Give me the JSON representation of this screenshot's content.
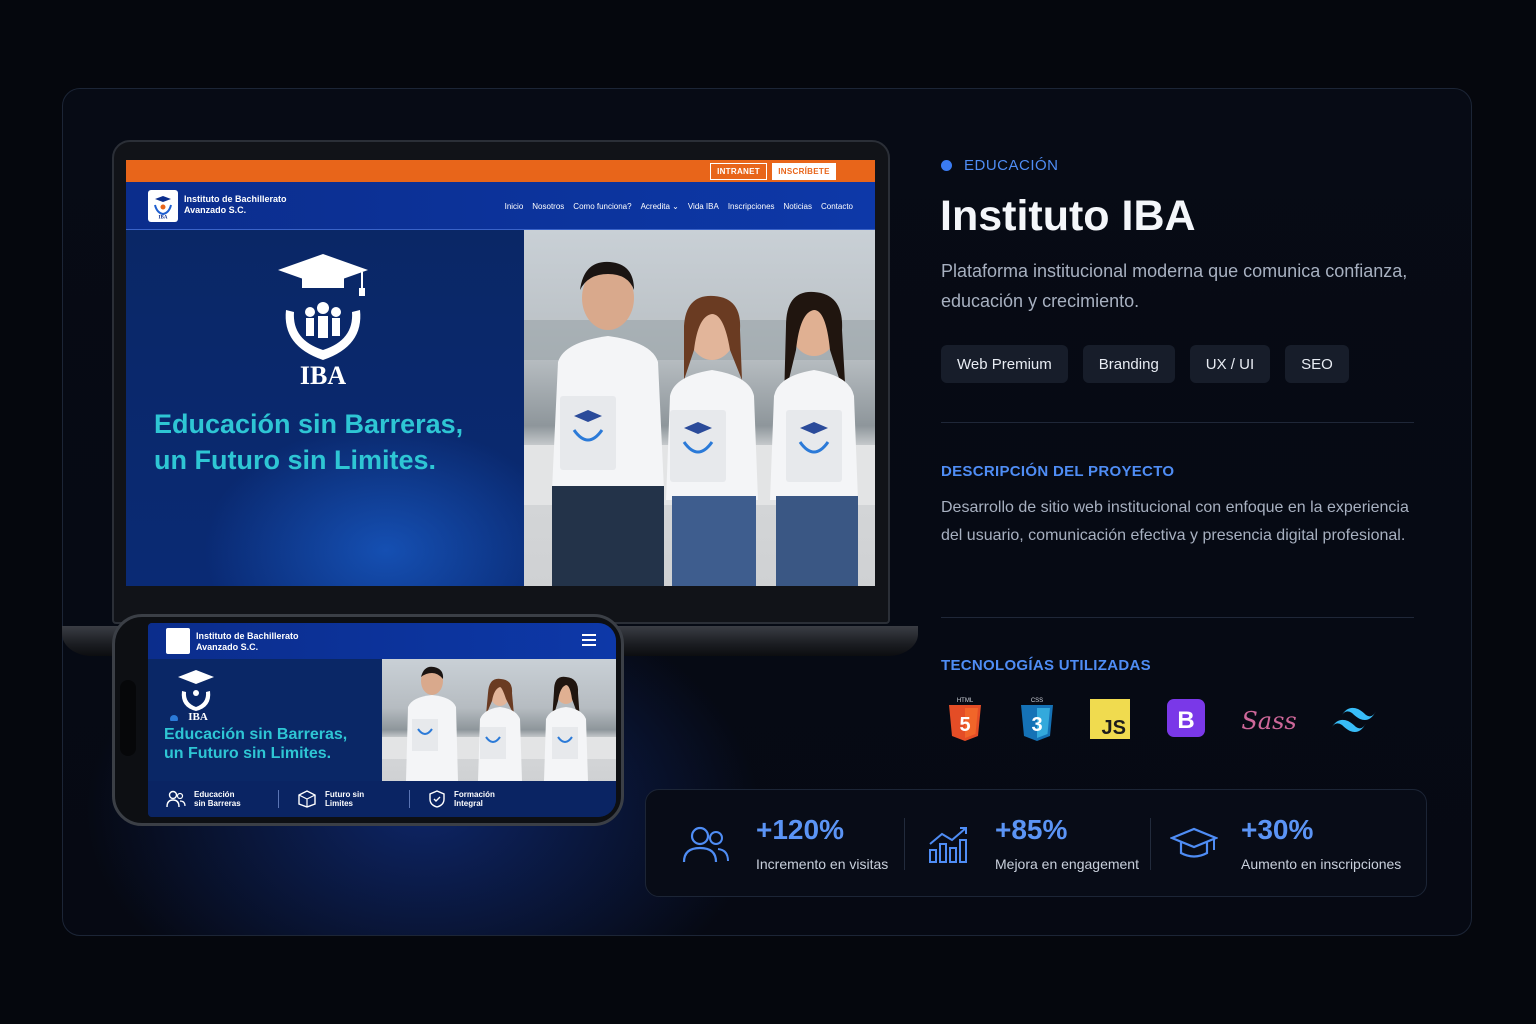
{
  "laptop_site": {
    "topbar": {
      "intranet": "INTRANET",
      "inscribete": "INSCRÍBETE"
    },
    "brand": {
      "line1": "Instituto de Bachillerato",
      "line2": "Avanzado S.C."
    },
    "nav": [
      "Inicio",
      "Nosotros",
      "Como funciona?",
      "Acredita ⌄",
      "Vida IBA",
      "Inscripciones",
      "Noticias",
      "Contacto"
    ],
    "logo_text": "IBA",
    "hero": {
      "line1": "Educación sin Barreras,",
      "line2": "un Futuro sin Limites."
    }
  },
  "phone_site": {
    "brand": {
      "line1": "Instituto de Bachillerato",
      "line2": "Avanzado S.C."
    },
    "logo_text": "IBA",
    "hero": {
      "line1": "Educación sin Barreras,",
      "line2": "un Futuro sin Limites."
    },
    "features": [
      {
        "line1": "Educación",
        "line2": "sin Barreras",
        "icon": "people-icon"
      },
      {
        "line1": "Futuro sin",
        "line2": "Limites",
        "icon": "box-icon"
      },
      {
        "line1": "Formación",
        "line2": "Integral",
        "icon": "shield-icon"
      }
    ]
  },
  "project": {
    "category": "EDUCACIÓN",
    "title": "Instituto IBA",
    "subtitle": "Plataforma institucional moderna que comunica confianza, educación y crecimiento.",
    "tags": [
      "Web Premium",
      "Branding",
      "UX / UI",
      "SEO"
    ],
    "description_heading": "DESCRIPCIÓN DEL PROYECTO",
    "description": "Desarrollo de sitio web institucional con enfoque en la experiencia del usuario, comunicación efectiva y presencia digital profesional.",
    "tech_heading": "TECNOLOGÍAS UTILIZADAS",
    "technologies": [
      {
        "name": "html5-icon",
        "label": "HTML",
        "glyph": "5",
        "color": "#e44d26"
      },
      {
        "name": "css3-icon",
        "label": "CSS",
        "glyph": "3",
        "color": "#1572b6"
      },
      {
        "name": "javascript-icon",
        "glyph": "JS",
        "color": "#f0db4f"
      },
      {
        "name": "bootstrap-icon",
        "glyph": "B",
        "color": "#7a38e8"
      },
      {
        "name": "sass-icon",
        "glyph": "Sass",
        "color": "#cd6799"
      },
      {
        "name": "tailwind-icon",
        "color": "#38bdf8"
      }
    ]
  },
  "stats": [
    {
      "value": "+120%",
      "label": "Incremento en visitas",
      "icon": "users-icon"
    },
    {
      "value": "+85%",
      "label": "Mejora en engagement",
      "icon": "growth-chart-icon"
    },
    {
      "value": "+30%",
      "label": "Aumento en inscripciones",
      "icon": "graduation-cap-icon"
    }
  ],
  "colors": {
    "accent": "#4f8df5",
    "hero_text": "#2ec6d4",
    "site_orange": "#e8651a",
    "site_blue": "#0b2d8c"
  }
}
